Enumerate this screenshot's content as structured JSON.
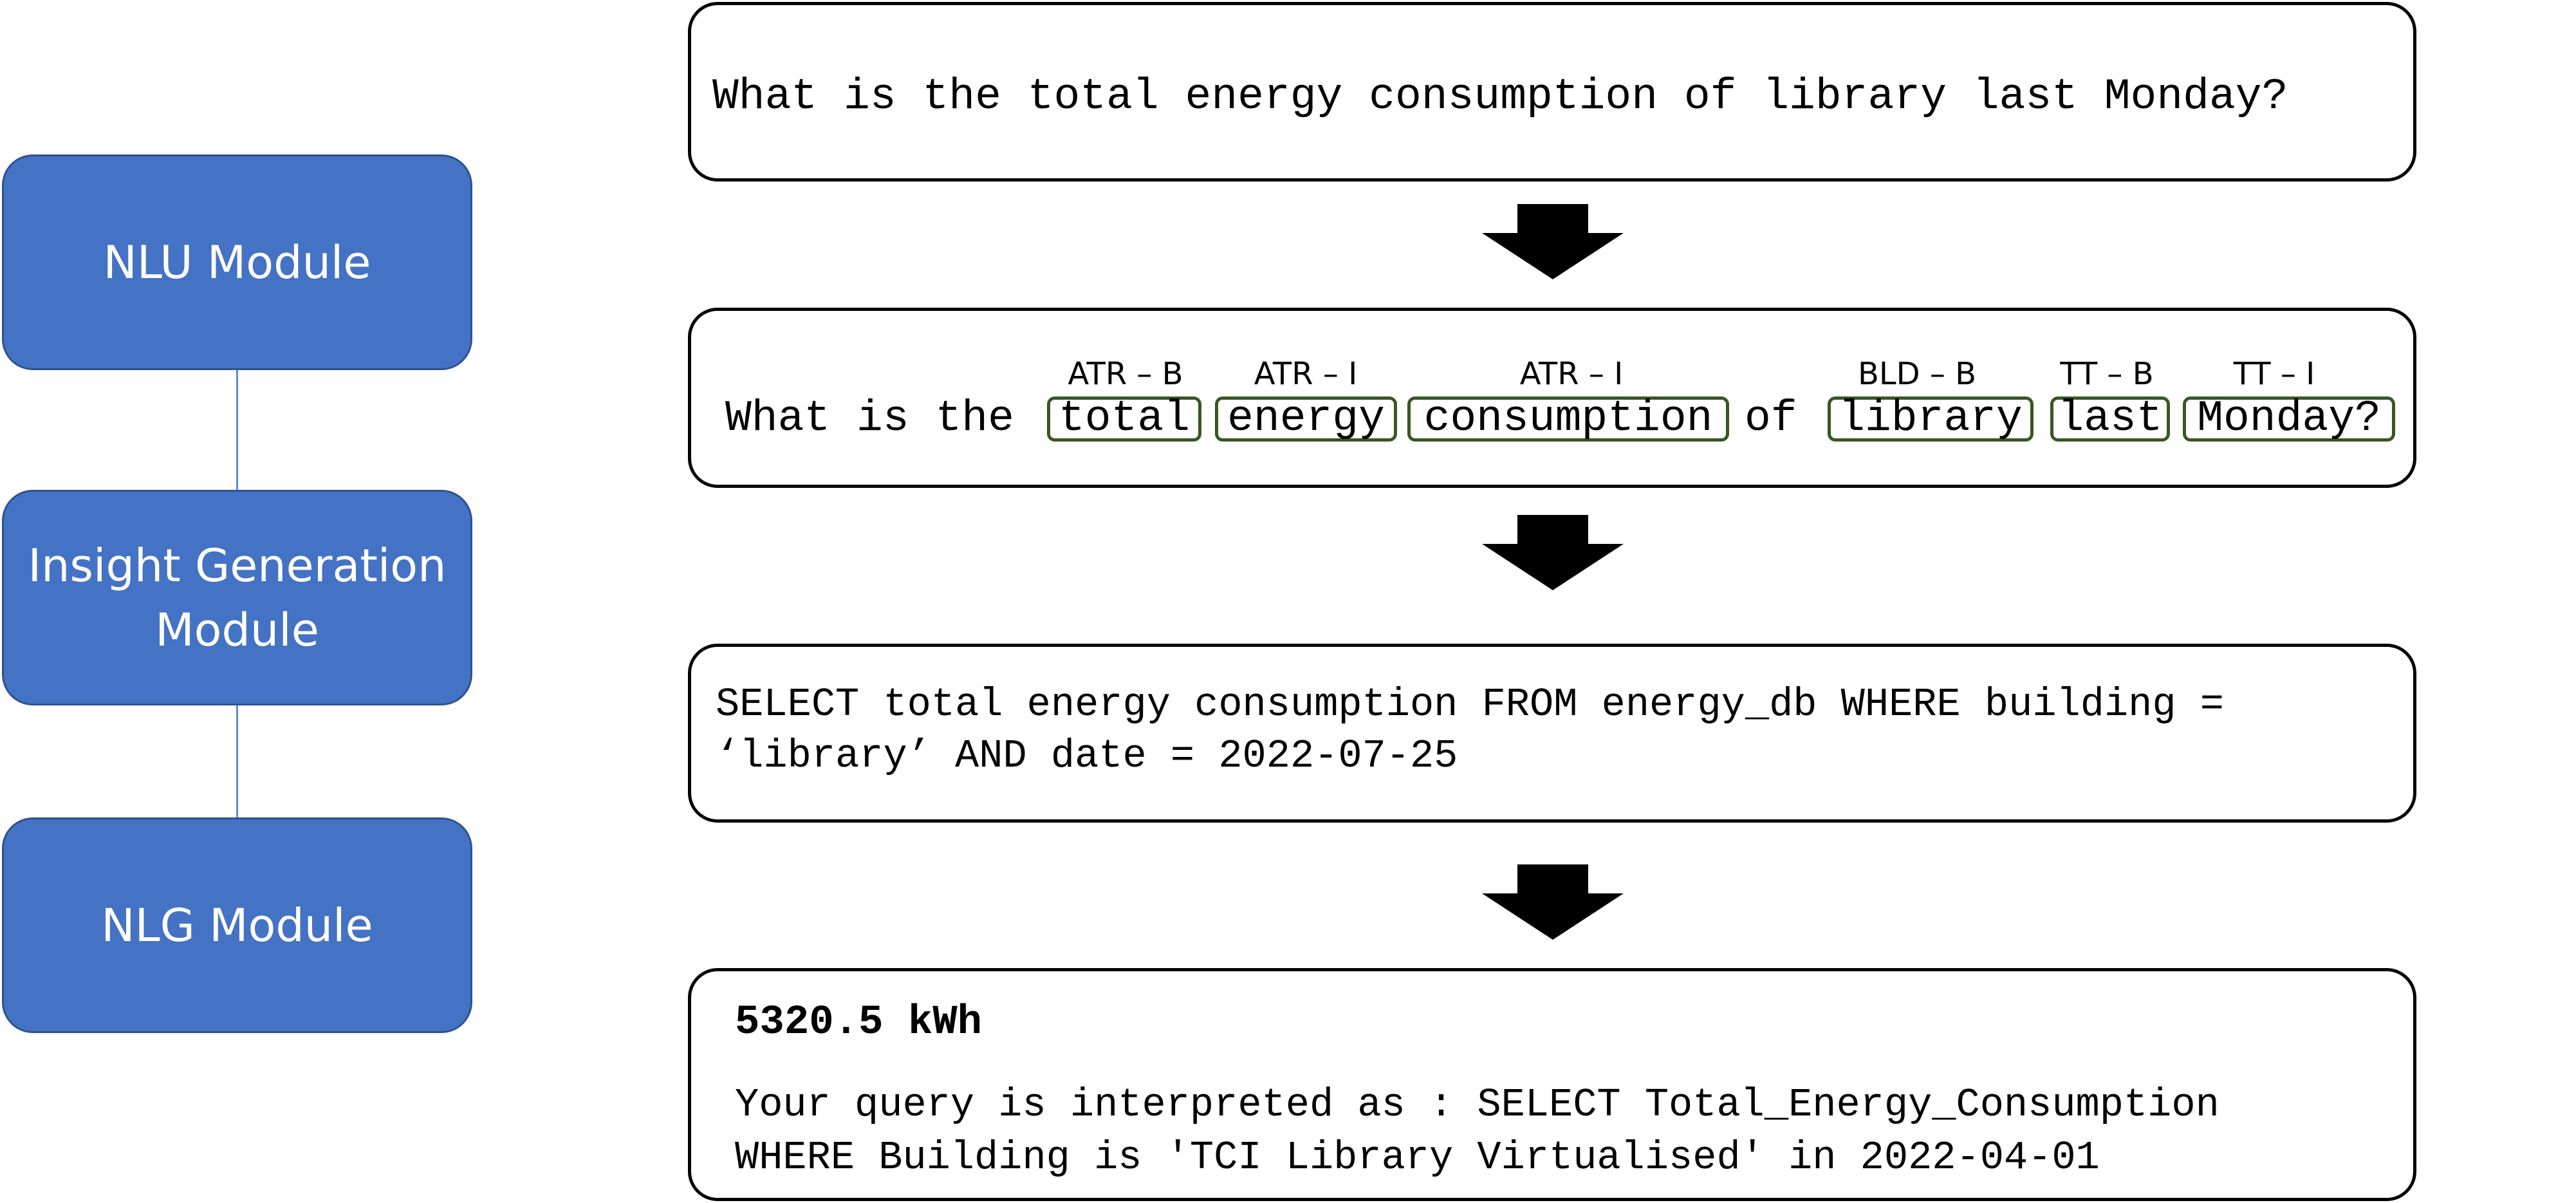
{
  "modules": {
    "nlu": [
      "NLU Module"
    ],
    "insight": [
      "Insight Generation",
      "Module"
    ],
    "nlg": [
      "NLG Module"
    ]
  },
  "query": {
    "text": "What is the total energy consumption of library last Monday?"
  },
  "tagged": {
    "plain_1": "What is the",
    "plain_2": "of",
    "tokens": [
      {
        "word": "total",
        "tag": "ATR – B"
      },
      {
        "word": "energy",
        "tag": "ATR – I"
      },
      {
        "word": "consumption",
        "tag": "ATR – I"
      },
      {
        "word": "library",
        "tag": "BLD – B"
      },
      {
        "word": "last",
        "tag": "TT – B"
      },
      {
        "word": "Monday?",
        "tag": "TT – I"
      }
    ]
  },
  "sql": {
    "line1": "SELECT total energy consumption FROM energy_db WHERE building =",
    "line2": "‘library’ AND date = 2022-07-25"
  },
  "answer": {
    "value": "5320.5 kWh",
    "line1": "Your query is interpreted as : SELECT Total_Energy_Consumption",
    "line2": "WHERE Building is 'TCI Library Virtualised' in 2022-04-01"
  },
  "colors": {
    "module_fill": "#4472c4",
    "module_border": "#2f528f",
    "connector": "#5b8fd6",
    "token_border": "#385723",
    "arrow": "#000000"
  }
}
